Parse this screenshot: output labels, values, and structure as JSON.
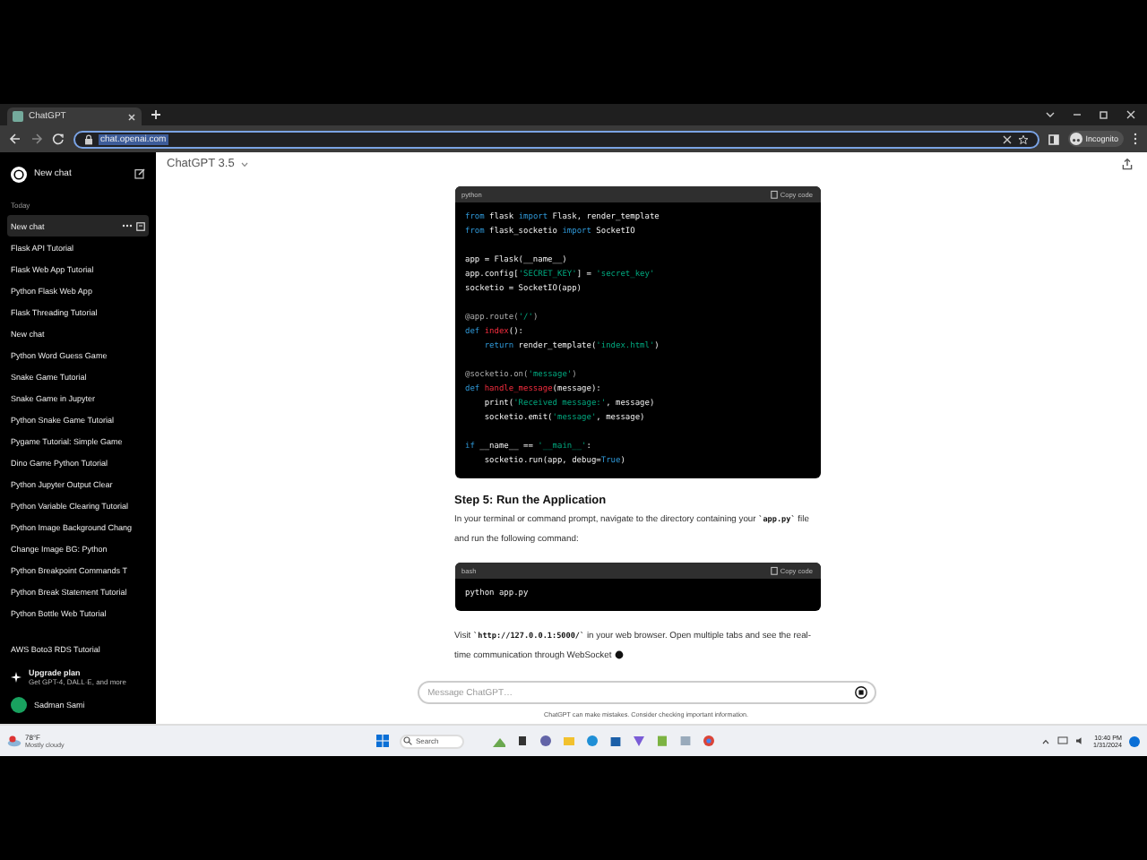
{
  "browser": {
    "tab": {
      "title": "ChatGPT"
    },
    "address": {
      "url": "chat.openai.com",
      "selected": true
    },
    "profile": {
      "label": "Incognito"
    }
  },
  "sidebar": {
    "new_chat": "New chat",
    "section": "Today",
    "items": [
      {
        "label": "New chat",
        "selected": true
      },
      {
        "label": "Flask API Tutorial",
        "selected": false
      },
      {
        "label": "Flask Web App Tutorial",
        "selected": false
      },
      {
        "label": "Python Flask Web App",
        "selected": false
      },
      {
        "label": "Flask Threading Tutorial",
        "selected": false
      },
      {
        "label": "New chat",
        "selected": false
      },
      {
        "label": "Python Word Guess Game",
        "selected": false
      },
      {
        "label": "Snake Game Tutorial",
        "selected": false
      },
      {
        "label": "Snake Game in Jupyter",
        "selected": false
      },
      {
        "label": "Python Snake Game Tutorial",
        "selected": false
      },
      {
        "label": "Pygame Tutorial: Simple Game",
        "selected": false
      },
      {
        "label": "Dino Game Python Tutorial",
        "selected": false
      },
      {
        "label": "Python Jupyter Output Clear",
        "selected": false
      },
      {
        "label": "Python Variable Clearing Tutorial",
        "selected": false
      },
      {
        "label": "Python Image Background Chang",
        "selected": false
      },
      {
        "label": "Change Image BG: Python",
        "selected": false
      },
      {
        "label": "Python Breakpoint Commands T",
        "selected": false
      },
      {
        "label": "Python Break Statement Tutorial",
        "selected": false
      },
      {
        "label": "Python Bottle Web Tutorial",
        "selected": false
      }
    ],
    "older_items": [
      {
        "label": "AWS Boto3 RDS Tutorial",
        "selected": false
      }
    ],
    "upgrade": {
      "title": "Upgrade plan",
      "subtitle": "Get GPT-4, DALL·E, and more"
    },
    "user": {
      "name": "Sadman Sami"
    }
  },
  "header": {
    "model": "ChatGPT 3.5"
  },
  "conversation": [
    {
      "kind": "code",
      "language": "python",
      "copy": "Copy code",
      "groups": [
        [
          [
            {
              "kind": "kw",
              "text": "from"
            },
            {
              "kind": "plain",
              "text": " flask "
            },
            {
              "kind": "kw",
              "text": "import"
            },
            {
              "kind": "plain",
              "text": " Flask, render_template"
            }
          ],
          [
            {
              "kind": "kw",
              "text": "from"
            },
            {
              "kind": "plain",
              "text": " flask_socketio "
            },
            {
              "kind": "kw",
              "text": "import"
            },
            {
              "kind": "plain",
              "text": " SocketIO"
            }
          ]
        ],
        [
          [
            {
              "kind": "plain",
              "text": "app = Flask(__name__)"
            }
          ],
          [
            {
              "kind": "plain",
              "text": "app.config["
            },
            {
              "kind": "str",
              "text": "'SECRET_KEY'"
            },
            {
              "kind": "plain",
              "text": "] = "
            },
            {
              "kind": "str",
              "text": "'secret_key'"
            }
          ],
          [
            {
              "kind": "plain",
              "text": "socketio = SocketIO(app)"
            }
          ]
        ],
        [
          [
            {
              "kind": "dec",
              "text": "@app.route("
            },
            {
              "kind": "str",
              "text": "'/'"
            },
            {
              "kind": "dec",
              "text": ")"
            }
          ],
          [
            {
              "kind": "kw",
              "text": "def "
            },
            {
              "kind": "fn",
              "text": "index"
            },
            {
              "kind": "plain",
              "text": "():"
            }
          ],
          [
            {
              "kind": "kw",
              "text": "    return"
            },
            {
              "kind": "plain",
              "text": " render_template("
            },
            {
              "kind": "str",
              "text": "'index.html'"
            },
            {
              "kind": "plain",
              "text": ")"
            }
          ]
        ],
        [
          [
            {
              "kind": "dec",
              "text": "@socketio.on("
            },
            {
              "kind": "str",
              "text": "'message'"
            },
            {
              "kind": "dec",
              "text": ")"
            }
          ],
          [
            {
              "kind": "kw",
              "text": "def "
            },
            {
              "kind": "fn",
              "text": "handle_message"
            },
            {
              "kind": "plain",
              "text": "(message):"
            }
          ],
          [
            {
              "kind": "plain",
              "text": "    print("
            },
            {
              "kind": "str",
              "text": "'Received message:'"
            },
            {
              "kind": "plain",
              "text": ", message)"
            }
          ],
          [
            {
              "kind": "plain",
              "text": "    socketio.emit("
            },
            {
              "kind": "str",
              "text": "'message'"
            },
            {
              "kind": "plain",
              "text": ", message)"
            }
          ]
        ],
        [
          [
            {
              "kind": "kw",
              "text": "if"
            },
            {
              "kind": "plain",
              "text": " __name__ == "
            },
            {
              "kind": "str",
              "text": "'__main__'"
            },
            {
              "kind": "plain",
              "text": ":"
            }
          ],
          [
            {
              "kind": "plain",
              "text": "    socketio.run(app, debug="
            },
            {
              "kind": "kw",
              "text": "True"
            },
            {
              "kind": "plain",
              "text": ")"
            }
          ]
        ]
      ]
    },
    {
      "kind": "heading",
      "text": "Step 5: Run the Application"
    },
    {
      "kind": "paragraph",
      "parts": [
        {
          "kind": "text",
          "text": "In your terminal or command prompt, navigate to the directory containing your "
        },
        {
          "kind": "code",
          "text": "`app.py`"
        },
        {
          "kind": "text",
          "text": " file and run the following command:"
        }
      ]
    },
    {
      "kind": "code",
      "language": "bash",
      "copy": "Copy code",
      "groups": [
        [
          [
            {
              "kind": "plain",
              "text": "python app.py"
            }
          ]
        ]
      ]
    },
    {
      "kind": "paragraph",
      "streaming": true,
      "parts": [
        {
          "kind": "text",
          "text": "Visit "
        },
        {
          "kind": "code",
          "text": "`http://127.0.0.1:5000/`"
        },
        {
          "kind": "text",
          "text": " in your web browser. Open multiple tabs and see the real-time communication through WebSocket"
        }
      ]
    }
  ],
  "composer": {
    "placeholder": "Message ChatGPT…"
  },
  "disclaimer": "ChatGPT can make mistakes. Consider checking important information.",
  "taskbar": {
    "weather": {
      "temp": "78°F",
      "condition": "Mostly cloudy"
    },
    "search": {
      "placeholder": "Search"
    },
    "time": "10:40 PM",
    "date": "1/31/2024"
  }
}
